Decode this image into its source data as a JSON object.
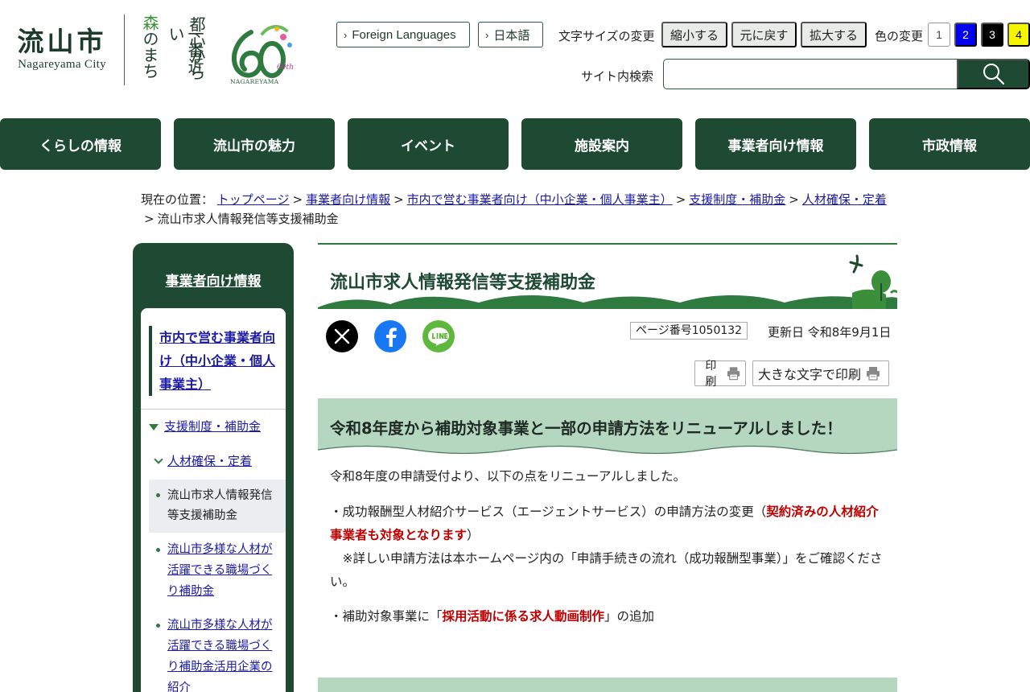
{
  "header": {
    "logo": {
      "city_kanji": "流山市",
      "city_roman": "Nagareyama City",
      "slogan_col1": "都心から",
      "slogan_col2": "一番近い",
      "slogan_col3_a": "森",
      "slogan_col3_b": "のまち",
      "anniversary_mark": "60th",
      "anniversary_caption": "NAGAREYAMA"
    },
    "lang_foreign": "Foreign Languages",
    "lang_ja": "日本語",
    "font_size_label": "文字サイズの変更",
    "font_small": "縮小する",
    "font_reset": "元に戻す",
    "font_large": "拡大する",
    "color_label": "色の変更",
    "color_options": [
      "1",
      "2",
      "3",
      "4"
    ],
    "search_label": "サイト内検索",
    "search_placeholder": ""
  },
  "global_nav": [
    "くらしの情報",
    "流山市の魅力",
    "イベント",
    "施設案内",
    "事業者向け情報",
    "市政情報"
  ],
  "breadcrumb": {
    "label": "現在の位置：",
    "links": [
      "トップページ",
      "事業者向け情報",
      "市内で営む事業者向け（中小企業・個人事業主）",
      "支援制度・補助金",
      "人材確保・定着"
    ],
    "separator": ">",
    "current": "流山市求人情報発信等支援補助金"
  },
  "sidebar": {
    "title": "事業者向け情報",
    "category": "市内で営む事業者向け（中小企業・個人事業主）",
    "sub1": "支援制度・補助金",
    "sub2": "人材確保・定着",
    "current": "流山市求人情報発信等支援補助金",
    "links": [
      "流山市多様な人材が活躍できる職場づくり補助金",
      "流山市多様な人材が活躍できる職場づくり補助金活用企業の紹介"
    ]
  },
  "main": {
    "title": "流山市求人情報発信等支援補助金",
    "page_number": "ページ番号1050132",
    "updated": "更新日 令和8年9月1日",
    "print": "印刷",
    "print_large": "大きな文字で印刷",
    "section_heading": "令和8年度から補助対象事業と一部の申請方法をリニューアルしました！",
    "p1": "令和8年度の申請受付より、以下の点をリニューアルしました。",
    "p2_a": "・成功報酬型人材紹介サービス（エージェントサービス）の申請方法の変更（",
    "p2_red": "契約済みの人材紹介事業者も対象となります",
    "p2_b": "）",
    "p2_note": "　※詳しい申請方法は本ホームページ内の「申請手続きの流れ（成功報酬型事業）」をご確認ください。",
    "p3_a": "・補助対象事業に「",
    "p3_red": "採用活動に係る求人動画制作",
    "p3_b": "」の追加"
  },
  "colors": {
    "primary_green": "#1e4a33",
    "light_green": "#b5d6bf",
    "emphasis_red": "#c00000",
    "link_blue": "#1a1aa6"
  }
}
